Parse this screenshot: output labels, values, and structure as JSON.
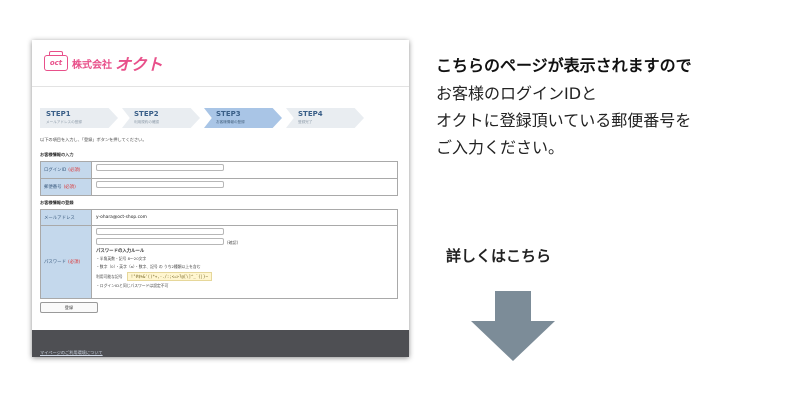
{
  "shot": {
    "logo": {
      "mark": "oct",
      "text": "株式会社",
      "brand": "オクト"
    },
    "steps": [
      {
        "title": "STEP1",
        "sub": "メールアドレスの登録",
        "active": false
      },
      {
        "title": "STEP2",
        "sub": "利用規約の確認",
        "active": false
      },
      {
        "title": "STEP3",
        "sub": "お客様情報の登録",
        "active": true
      },
      {
        "title": "STEP4",
        "sub": "登録完了",
        "active": false
      }
    ],
    "instruction": "以下の項目を入力し、「登録」ボタンを押してください。",
    "section1": "お客様情報の入力",
    "login_label": "ログインID",
    "zip_label": "郵便番号",
    "required": "(必須)",
    "section2": "お客様情報の登録",
    "email_label": "メールアドレス",
    "email_value": "y-ohara@oct-shop.com",
    "password_label": "パスワード",
    "required2": "(必須)",
    "confirm": "(確認)",
    "pw_rules_title": "パスワードの入力ルール",
    "pw_rule1": "・半角英数・記号 8〜20文字",
    "pw_rule2": "・数字（0）・英字（a）・数字、記号 の うち2種類以上を含む",
    "pw_rule3_label": "利用可能な記号",
    "pw_symbols": "!\"#$%&'()*+,-./:;<=>?@[\\]^_`{|}~",
    "pw_rule4": "・ログインIDと同じパスワードは設定不可",
    "register_button": "登録",
    "footer_link": "マイページのご利用環境について"
  },
  "right": {
    "heading": "こちらのページが表示されますので",
    "line1": "お客様のログインIDと",
    "line2": "オクトに登録頂いている郵便番号を",
    "line3": "ご入力ください。",
    "more": "詳しくはこちら",
    "arrow_color": "#7c8c98"
  }
}
